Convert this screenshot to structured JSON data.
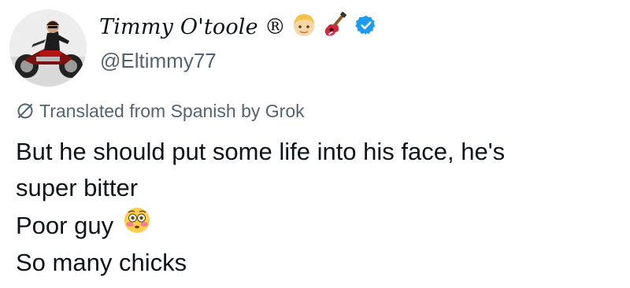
{
  "author": {
    "display_name": "Timmy O'toole",
    "registered_mark": "®",
    "handle": "@Eltimmy77",
    "badge_emojis": [
      "blond-person-emoji",
      "guitar-emoji"
    ],
    "verified": true,
    "verified_color": "#1d9bf0"
  },
  "translation": {
    "note": "Translated from Spanish by Grok",
    "icon": "grok-icon"
  },
  "body": {
    "lines": [
      "But he should put some life into his face, he's",
      "super bitter",
      "Poor guy",
      "So many chicks"
    ],
    "inline_emoji": "flushed-face-emoji"
  },
  "colors": {
    "text": "#0f1419",
    "secondary": "#536471"
  }
}
